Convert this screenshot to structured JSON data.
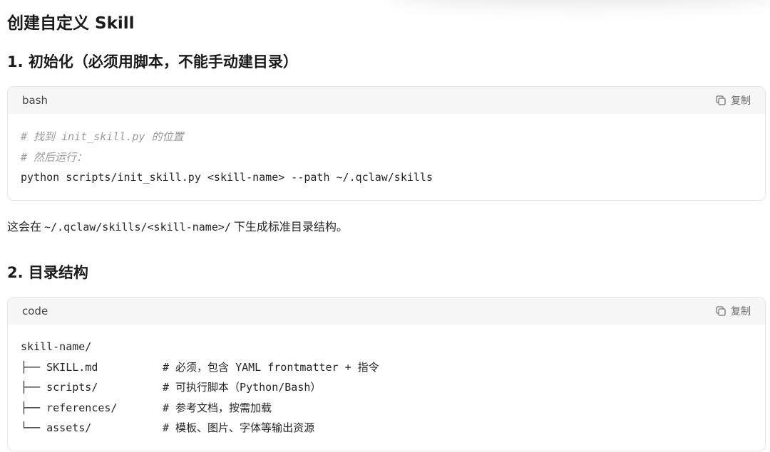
{
  "title": "创建自定义 Skill",
  "section1": {
    "heading": "1. 初始化（必须用脚本，不能手动建目录）",
    "code": {
      "lang": "bash",
      "copy_label": "复制",
      "comment1": "# 找到 init_skill.py 的位置",
      "comment2": "# 然后运行：",
      "command": "python scripts/init_skill.py <skill-name> --path ~/.qclaw/skills"
    }
  },
  "paragraph": {
    "prefix": "这会在",
    "path": "~/.qclaw/skills/<skill-name>/",
    "suffix": "下生成标准目录结构。"
  },
  "section2": {
    "heading": "2. 目录结构",
    "code": {
      "lang": "code",
      "copy_label": "复制",
      "root": "skill-name/",
      "items": [
        {
          "name": "├── SKILL.md",
          "comment": "# 必须，包含 YAML frontmatter + 指令"
        },
        {
          "name": "├── scripts/",
          "comment": "# 可执行脚本（Python/Bash）"
        },
        {
          "name": "├── references/",
          "comment": "# 参考文档，按需加载"
        },
        {
          "name": "└── assets/",
          "comment": "# 模板、图片、字体等输出资源"
        }
      ]
    }
  }
}
